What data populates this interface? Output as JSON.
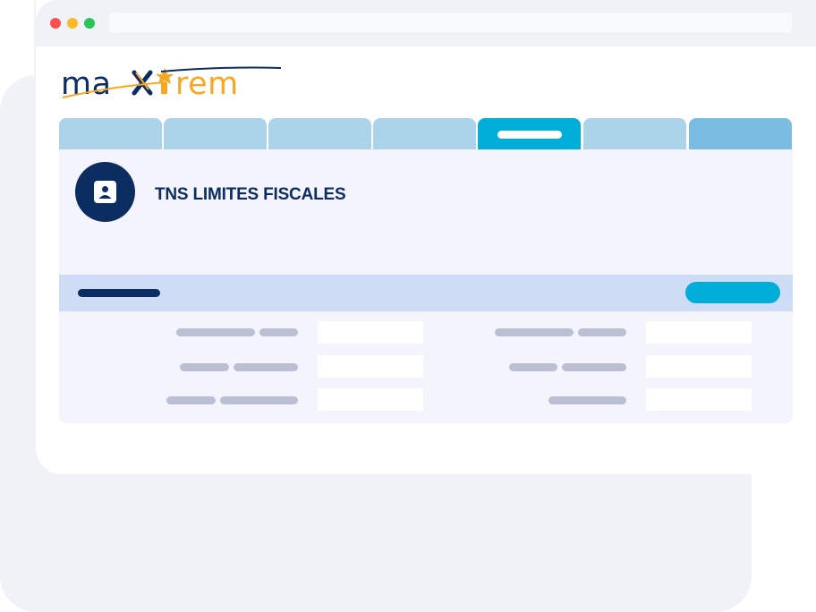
{
  "browser": {
    "buttons": [
      "close",
      "minimize",
      "maximize"
    ],
    "address_bar": ""
  },
  "app": {
    "logo_text": "maxirem",
    "colors": {
      "brand_navy": "#0c2d61",
      "brand_orange": "#f7a823",
      "accent_cyan": "#00afd9",
      "tab_blue": "#abd3ea",
      "panel_bg": "#f3f4fc",
      "section_bg": "#cfdcf6",
      "placeholder_gray": "#bbbfd3"
    }
  },
  "tabs": {
    "count": 7,
    "active_index": 4,
    "labels": [
      "",
      "",
      "",
      "",
      "",
      "",
      ""
    ]
  },
  "page": {
    "title": "TNS LIMITES FISCALES",
    "icon": "id-card-icon"
  },
  "section": {
    "title": "",
    "action_label": ""
  },
  "form": {
    "left_column": [
      {
        "label": "",
        "value": ""
      },
      {
        "label": "",
        "value": ""
      },
      {
        "label": "",
        "value": ""
      }
    ],
    "right_column": [
      {
        "label": "",
        "value": ""
      },
      {
        "label": "",
        "value": ""
      },
      {
        "label": "",
        "value": ""
      }
    ]
  }
}
